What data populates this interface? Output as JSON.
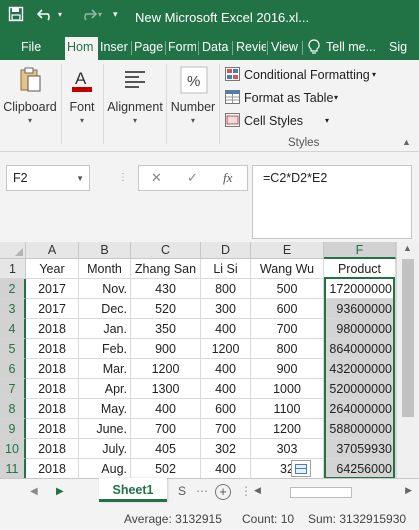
{
  "window": {
    "title": "New Microsoft Excel 2016.xl...",
    "save_icon": "save-icon",
    "undo_icon": "undo-icon",
    "redo_icon": "redo-icon",
    "accent_color": "#217346"
  },
  "ribbon_tabs": [
    "File",
    "Hom",
    "Inser",
    "Page",
    "Form",
    "Data",
    "Revie",
    "View",
    "Tell me...",
    "Sig"
  ],
  "ribbon": {
    "clipboard_label": "Clipboard",
    "font_label": "Font",
    "alignment_label": "Alignment",
    "number_label": "Number",
    "conditional_formatting": "Conditional Formatting",
    "format_as_table": "Format as Table",
    "cell_styles": "Cell Styles",
    "styles_group": "Styles"
  },
  "formula_bar": {
    "name_box": "F2",
    "cancel_icon": "✕",
    "enter_icon": "✓",
    "fx_label": "fx",
    "formula": "=C2*D2*E2"
  },
  "grid": {
    "column_headers": [
      "A",
      "B",
      "C",
      "D",
      "E",
      "F"
    ],
    "selected_column": "F",
    "header_row": [
      "Year",
      "Month",
      "Zhang San",
      "Li Si",
      "Wang Wu",
      "Product"
    ],
    "rows": [
      {
        "num": "2",
        "cells": [
          "2017",
          "Nov.",
          "430",
          "800",
          "500",
          "172000000"
        ]
      },
      {
        "num": "3",
        "cells": [
          "2017",
          "Dec.",
          "520",
          "300",
          "600",
          "93600000"
        ]
      },
      {
        "num": "4",
        "cells": [
          "2018",
          "Jan.",
          "350",
          "400",
          "700",
          "98000000"
        ]
      },
      {
        "num": "5",
        "cells": [
          "2018",
          "Feb.",
          "900",
          "1200",
          "800",
          "864000000"
        ]
      },
      {
        "num": "6",
        "cells": [
          "2018",
          "Mar.",
          "1200",
          "400",
          "900",
          "432000000"
        ]
      },
      {
        "num": "7",
        "cells": [
          "2018",
          "Apr.",
          "1300",
          "400",
          "1000",
          "520000000"
        ]
      },
      {
        "num": "8",
        "cells": [
          "2018",
          "May.",
          "400",
          "600",
          "1100",
          "264000000"
        ]
      },
      {
        "num": "9",
        "cells": [
          "2018",
          "June.",
          "700",
          "700",
          "1200",
          "588000000"
        ]
      },
      {
        "num": "10",
        "cells": [
          "2018",
          "July.",
          "405",
          "302",
          "303",
          "37059930"
        ]
      },
      {
        "num": "11",
        "cells": [
          "2018",
          "Aug.",
          "502",
          "400",
          "32",
          "64256000"
        ]
      }
    ]
  },
  "sheets": {
    "active": "Sheet1",
    "more": "S",
    "add_icon": "+"
  },
  "status": {
    "average": "Average: 3132915",
    "count": "Count: 10",
    "sum": "Sum: 3132915930"
  }
}
